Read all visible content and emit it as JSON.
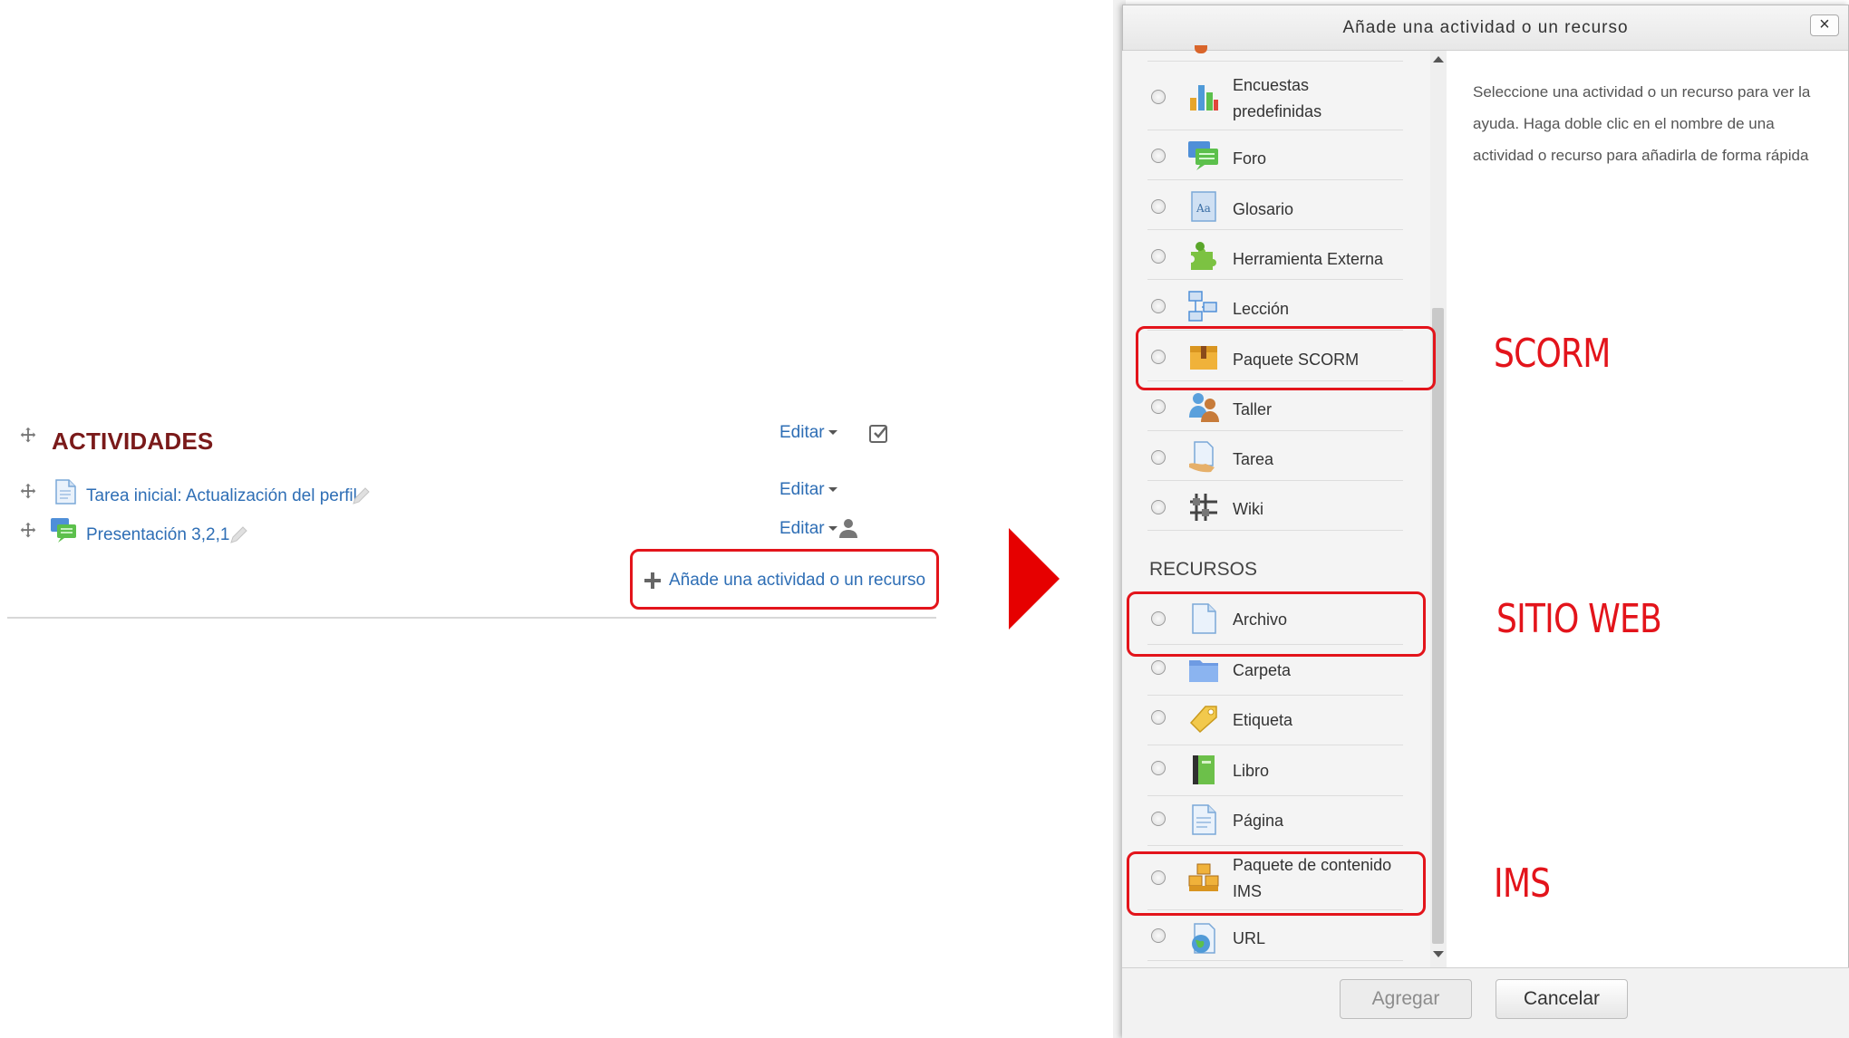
{
  "section": {
    "title": "ACTIVIDADES",
    "edit_label": "Editar",
    "activities": [
      {
        "label": "Tarea inicial: Actualización del perfil",
        "icon": "file-icon",
        "edit_label": "Editar"
      },
      {
        "label": "Presentación 3,2,1",
        "icon": "forum-icon",
        "edit_label": "Editar"
      }
    ],
    "add_label": "Añade una actividad o un recurso"
  },
  "modal": {
    "title": "Añade una actividad o un recurso",
    "close_label": "×",
    "help_text": "Seleccione una actividad o un recurso para ver la ayuda. Haga doble clic en el nombre de una actividad o recurso para añadirla de forma rápida",
    "activities": [
      {
        "label": "Encuestas predefinidas",
        "icon": "survey-chart-icon"
      },
      {
        "label": "Foro",
        "icon": "forum-icon"
      },
      {
        "label": "Glosario",
        "icon": "glossary-icon"
      },
      {
        "label": "Herramienta Externa",
        "icon": "puzzle-icon"
      },
      {
        "label": "Lección",
        "icon": "lesson-icon"
      },
      {
        "label": "Paquete SCORM",
        "icon": "scorm-package-icon"
      },
      {
        "label": "Taller",
        "icon": "workshop-icon"
      },
      {
        "label": "Tarea",
        "icon": "assignment-icon"
      },
      {
        "label": "Wiki",
        "icon": "wiki-icon"
      }
    ],
    "resources_heading": "RECURSOS",
    "resources": [
      {
        "label": "Archivo",
        "icon": "file-icon"
      },
      {
        "label": "Carpeta",
        "icon": "folder-icon"
      },
      {
        "label": "Etiqueta",
        "icon": "tag-icon"
      },
      {
        "label": "Libro",
        "icon": "book-icon"
      },
      {
        "label": "Página",
        "icon": "page-icon"
      },
      {
        "label": "Paquete de contenido IMS",
        "icon": "ims-package-icon"
      },
      {
        "label": "URL",
        "icon": "globe-icon"
      }
    ],
    "add_button": "Agregar",
    "cancel_button": "Cancelar"
  },
  "annotations": {
    "scorm": "SCORM",
    "sitio_web": "SITIO WEB",
    "ims": "IMS",
    "highlight_color": "#e3141b"
  }
}
